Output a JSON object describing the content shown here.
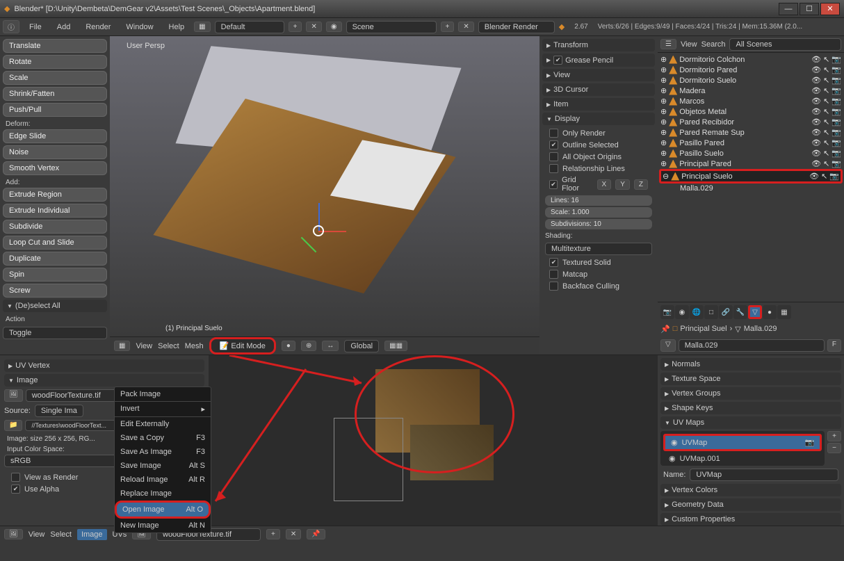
{
  "window": {
    "title": "Blender* [D:\\Unity\\Dembeta\\DemGear v2\\Assets\\Test Scenes\\_Objects\\Apartment.blend]"
  },
  "menubar": {
    "items": [
      "File",
      "Add",
      "Render",
      "Window",
      "Help"
    ],
    "layout": "Default",
    "scene": "Scene",
    "engine": "Blender Render",
    "version": "2.67",
    "stats": "Verts:6/26 | Edges:9/49 | Faces:4/24 | Tris:24 | Mem:15.36M (2.0..."
  },
  "tools": {
    "transform": [
      "Translate",
      "Rotate",
      "Scale",
      "Shrink/Fatten",
      "Push/Pull"
    ],
    "deform_label": "Deform:",
    "deform": [
      "Edge Slide",
      "Noise",
      "Smooth Vertex"
    ],
    "add_label": "Add:",
    "add": [
      "Extrude Region",
      "Extrude Individual",
      "Subdivide",
      "Loop Cut and Slide",
      "Duplicate",
      "Spin",
      "Screw"
    ],
    "deselect": "(De)select All",
    "action_label": "Action",
    "toggle": "Toggle"
  },
  "viewport": {
    "persp": "User Persp",
    "selected": "(1) Principal Suelo",
    "header_menus": [
      "View",
      "Select",
      "Mesh"
    ],
    "mode": "Edit Mode",
    "orientation": "Global"
  },
  "npanel": {
    "panels": [
      "Transform",
      "Grease Pencil",
      "View",
      "3D Cursor",
      "Item"
    ],
    "display_title": "Display",
    "only_render": "Only Render",
    "outline_selected": "Outline Selected",
    "all_origins": "All Object Origins",
    "relationship": "Relationship Lines",
    "grid_floor": "Grid Floor",
    "axes": [
      "X",
      "Y",
      "Z"
    ],
    "lines": "Lines: 16",
    "scale": "Scale: 1.000",
    "subdivisions": "Subdivisions: 10",
    "shading_title": "Shading:",
    "shading_mode": "Multitexture",
    "textured_solid": "Textured Solid",
    "matcap": "Matcap",
    "backface": "Backface Culling"
  },
  "outliner": {
    "menus": [
      "View",
      "Search"
    ],
    "scenes": "All Scenes",
    "items": [
      "Dormitorio Colchon",
      "Dormitorio Pared",
      "Dormitorio Suelo",
      "Madera",
      "Marcos",
      "Objetos Metal",
      "Pared Recibidor",
      "Pared Remate Sup",
      "Pasillo Pared",
      "Pasillo Suelo",
      "Principal Pared",
      "Principal Suelo"
    ],
    "child": "Malla.029"
  },
  "props": {
    "breadcrumb_obj": "Principal Suel",
    "breadcrumb_data": "Malla.029",
    "mesh_name": "Malla.029",
    "name_label": "Name:",
    "name_value": "UVMap",
    "panels": [
      "Normals",
      "Texture Space",
      "Vertex Groups",
      "Shape Keys"
    ],
    "uvmaps_title": "UV Maps",
    "uvmap_items": [
      "UVMap",
      "UVMap.001"
    ],
    "panels2": [
      "Vertex Colors",
      "Geometry Data",
      "Custom Properties"
    ]
  },
  "uveditor": {
    "panels": [
      "UV Vertex"
    ],
    "image_title": "Image",
    "image_name": "woodFloorTexture.tif",
    "source_label": "Source:",
    "source": "Single Ima",
    "path": "//Textures\\woodFloorText...",
    "image_info": "Image: size 256 x 256, RG...",
    "color_label": "Input Color Space:",
    "color_space": "sRGB",
    "view_as_render": "View as Render",
    "use_alpha": "Use Alpha",
    "footer_menus": [
      "View",
      "Select",
      "Image",
      "UVs"
    ],
    "footer_image": "woodFloorTexture.tif"
  },
  "context_menu": {
    "items": [
      {
        "label": "Pack Image",
        "key": ""
      },
      {
        "label": "Invert",
        "key": "▸"
      },
      {
        "label": "Edit Externally",
        "key": ""
      },
      {
        "label": "Save a Copy",
        "key": "F3"
      },
      {
        "label": "Save As Image",
        "key": "F3"
      },
      {
        "label": "Save Image",
        "key": "Alt S"
      },
      {
        "label": "Reload Image",
        "key": "Alt R"
      },
      {
        "label": "Replace Image",
        "key": ""
      },
      {
        "label": "Open Image",
        "key": "Alt O"
      },
      {
        "label": "New Image",
        "key": "Alt N"
      }
    ]
  }
}
